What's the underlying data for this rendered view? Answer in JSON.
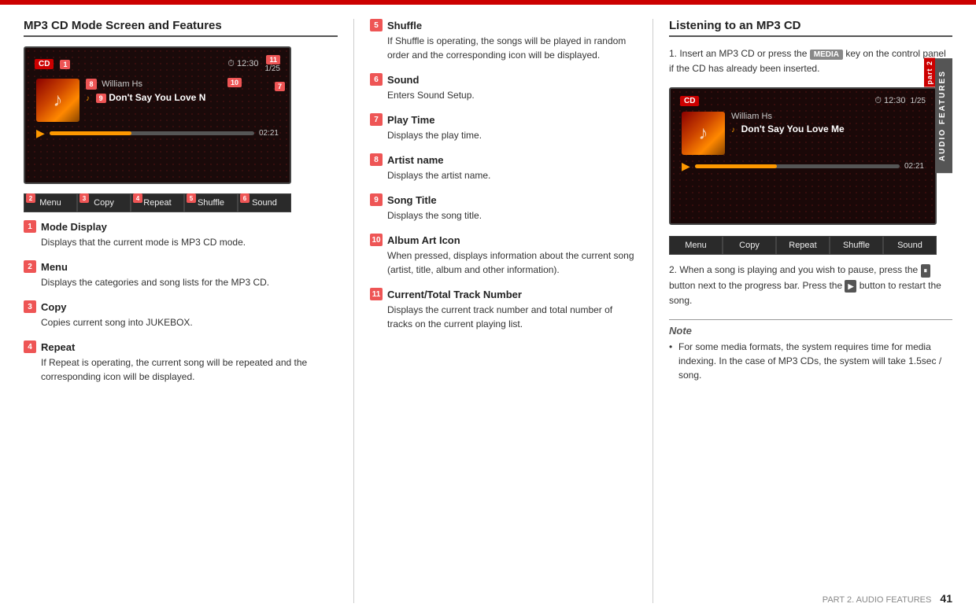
{
  "topbar": {
    "color": "#cc0000"
  },
  "left": {
    "title": "MP3 CD Mode Screen and Features",
    "player": {
      "cd_label": "CD",
      "badge1": "1",
      "time": "12:30",
      "clock_symbol": "⏱",
      "track_count": "1/25",
      "badge11": "11",
      "badge10": "10",
      "badge8": "8",
      "badge9": "9",
      "badge7": "7",
      "artist": "William Hs",
      "song_note": "♪",
      "song_title": "Don't Say You Love N",
      "elapsed": "02:21",
      "controls": [
        {
          "num": "2",
          "label": "Menu"
        },
        {
          "num": "3",
          "label": "Copy"
        },
        {
          "num": "4",
          "label": "Repeat"
        },
        {
          "num": "5",
          "label": "Shuffle"
        },
        {
          "num": "6",
          "label": "Sound"
        }
      ]
    },
    "features": [
      {
        "num": "1",
        "title": "Mode Display",
        "desc": "Displays that the current mode is MP3 CD mode."
      },
      {
        "num": "2",
        "title": "Menu",
        "desc": "Displays the categories and song lists for the MP3 CD."
      },
      {
        "num": "3",
        "title": "Copy",
        "desc": "Copies current song into JUKEBOX."
      },
      {
        "num": "4",
        "title": "Repeat",
        "desc": "If Repeat is operating, the current song will be repeated and the corresponding icon will be displayed."
      }
    ]
  },
  "mid": {
    "features": [
      {
        "num": "5",
        "title": "Shuffle",
        "desc": "If Shuffle is operating, the songs will be played in random order and the corresponding icon will be displayed."
      },
      {
        "num": "6",
        "title": "Sound",
        "desc": "Enters Sound Setup."
      },
      {
        "num": "7",
        "title": "Play Time",
        "desc": "Displays the play time."
      },
      {
        "num": "8",
        "title": "Artist name",
        "desc": "Displays the artist name."
      },
      {
        "num": "9",
        "title": "Song Title",
        "desc": "Displays the song title."
      },
      {
        "num": "10",
        "title": "Album Art Icon",
        "desc": "When pressed, displays information about the current song (artist, title, album and other information)."
      },
      {
        "num": "11",
        "title": "Current/Total Track Number",
        "desc": "Displays the current track number and total number of tracks on the current playing list."
      }
    ]
  },
  "right": {
    "title": "Listening to an MP3 CD",
    "steps": [
      {
        "num": "1.",
        "text": "Insert an MP3 CD or press the",
        "badge": "MEDIA",
        "text2": "key on the control panel if the CD has already been inserted."
      },
      {
        "num": "2.",
        "text": "When a song is playing and you wish to pause, press the",
        "pause_badge": "⏸",
        "text2": "button next to the progress bar. Press the",
        "play_badge": "▶",
        "text3": "button to restart the song."
      }
    ],
    "player": {
      "cd_label": "CD",
      "time": "12:30",
      "track_count": "1/25",
      "artist": "William Hs",
      "song_note": "♪",
      "song_title": "Don't Say You Love Me",
      "elapsed": "02:21",
      "controls": [
        "Menu",
        "Copy",
        "Repeat",
        "Shuffle",
        "Sound"
      ]
    },
    "note": {
      "title": "Note",
      "text": "For some media formats, the system requires time for media indexing. In the case of MP3 CDs, the system will take 1.5sec / song."
    }
  },
  "sidebar": {
    "part_label": "part 2",
    "section_label": "AUDIO FEATURES"
  },
  "footer": {
    "text": "PART 2. AUDIO FEATURES",
    "page": "41"
  }
}
